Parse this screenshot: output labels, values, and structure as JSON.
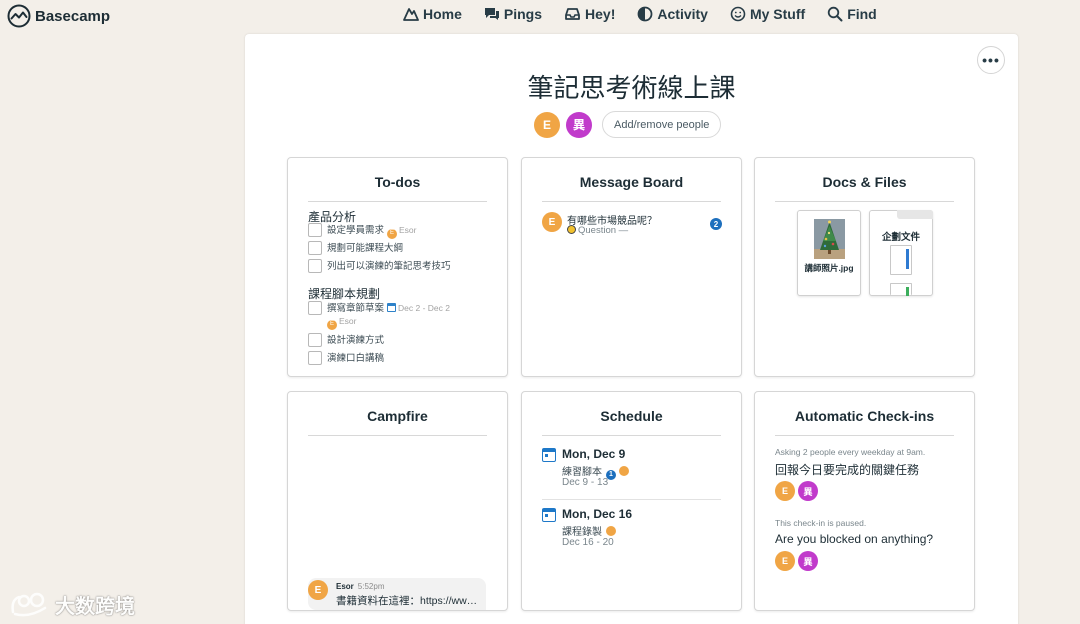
{
  "app": {
    "brand": "Basecamp"
  },
  "nav": {
    "home": "Home",
    "pings": "Pings",
    "hey": "Hey!",
    "activity": "Activity",
    "my_stuff": "My Stuff",
    "find": "Find"
  },
  "project": {
    "title": "筆記思考術線上課",
    "more_label": "•••",
    "people": [
      {
        "initial": "E"
      },
      {
        "initial": "異"
      }
    ],
    "add_people_label": "Add/remove people"
  },
  "todos": {
    "title": "To-dos",
    "groups": [
      {
        "name": "產品分析",
        "items": [
          {
            "text": "設定學員需求",
            "assignee": "Esor",
            "assignee_initial": "E"
          },
          {
            "text": "規劃可能課程大綱"
          },
          {
            "text": "列出可以演練的筆記思考技巧"
          }
        ]
      },
      {
        "name": "課程腳本規劃",
        "items": [
          {
            "text": "撰寫章節草案",
            "date_range": "Dec 2 - Dec 2",
            "assignee": "Esor",
            "assignee_initial": "E"
          },
          {
            "text": "設計演練方式"
          },
          {
            "text": "演練口白講稿"
          }
        ]
      }
    ]
  },
  "message_board": {
    "title": "Message Board",
    "messages": [
      {
        "author_initial": "E",
        "subject": "有哪些市場競品呢？",
        "category": "Question —",
        "comment_count": "2"
      }
    ]
  },
  "docs": {
    "title": "Docs & Files",
    "files": [
      {
        "name": "講師照片.jpg",
        "icon": "image-thumbnail"
      },
      {
        "name": "企劃文件",
        "icon": "folder-icon"
      }
    ]
  },
  "campfire": {
    "title": "Campfire",
    "last_line": {
      "author": "Esor",
      "author_initial": "E",
      "time": "5:52pm",
      "text": "書籍資料在這裡：https://ww…"
    }
  },
  "schedule": {
    "title": "Schedule",
    "events": [
      {
        "date": "Mon, Dec 9",
        "event": "練習腳本",
        "badge": "1",
        "range": "Dec 9 - 13"
      },
      {
        "date": "Mon, Dec 16",
        "event": "課程錄製",
        "range": "Dec 16 - 20"
      }
    ]
  },
  "checkins": {
    "title": "Automatic Check-ins",
    "items": [
      {
        "note": "Asking 2 people every weekday at 9am.",
        "question": "回報今日要完成的關鍵任務",
        "people": [
          "E",
          "異"
        ]
      },
      {
        "note": "This check-in is paused.",
        "question": "Are you blocked on anything?",
        "people": [
          "E",
          "異"
        ]
      }
    ]
  },
  "watermark": {
    "text": "大数跨境"
  },
  "colors": {
    "background": "#f3efe9",
    "avatar_e": "#f0a545",
    "avatar_x": "#c13bcb",
    "accent_blue": "#1d6fbd"
  }
}
